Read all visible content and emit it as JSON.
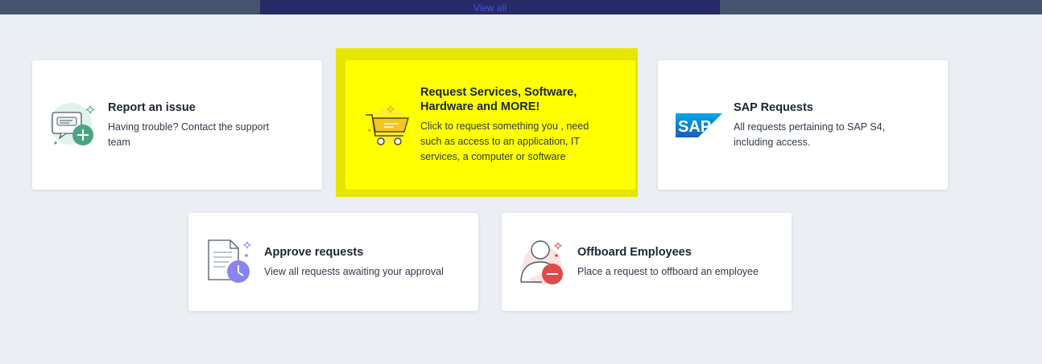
{
  "header": {
    "view_all_label": "View all"
  },
  "cards": [
    {
      "title": "Report an issue",
      "description": "Having trouble? Contact the support team",
      "icon": "support-ticket-icon"
    },
    {
      "title": "Request Services, Software, Hardware and MORE!",
      "description": "Click to request something you , need such as access to an application, IT services, a computer or software",
      "icon": "shopping-cart-icon",
      "highlighted": true,
      "highlight_color": "#ffff00"
    },
    {
      "title": "SAP Requests",
      "description": "All requests pertaining to SAP S4, including access.",
      "icon": "sap-logo-icon",
      "logo_text": "SAP"
    },
    {
      "title": "Approve requests",
      "description": "View all requests awaiting your approval",
      "icon": "document-clock-icon"
    },
    {
      "title": "Offboard Employees",
      "description": "Place a request to offboard an employee",
      "icon": "user-remove-icon"
    }
  ],
  "colors": {
    "page_background": "#ebeef2",
    "top_strip": "#44546d",
    "view_all_bar": "#262a66",
    "link": "#4455e0",
    "highlight": "#ffff00"
  }
}
